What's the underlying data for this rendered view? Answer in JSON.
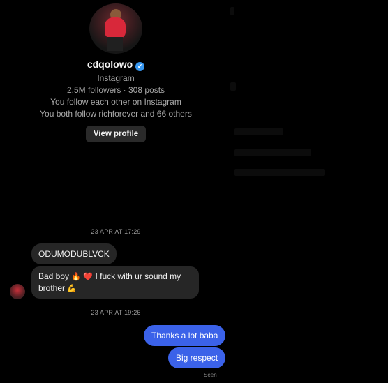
{
  "profile": {
    "username": "cdqolowo",
    "platform": "Instagram",
    "stats": "2.5M followers · 308 posts",
    "follow_status": "You follow each other on Instagram",
    "mutuals": "You both follow richforever and 66 others",
    "view_profile_label": "View profile"
  },
  "thread": {
    "timestamp_1": "23 APR AT 17:29",
    "incoming": [
      {
        "text": "ODUMODUBLVCK"
      },
      {
        "text_a": "Bad boy ",
        "emoji_1": "🔥",
        "emoji_2": "❤️",
        "text_b": " I fuck with ur sound my brother ",
        "emoji_3": "💪"
      }
    ],
    "timestamp_2": "23 APR AT 19:26",
    "outgoing": [
      {
        "text": "Thanks a lot baba"
      },
      {
        "text": "Big respect"
      }
    ],
    "seen_label": "Seen"
  },
  "colors": {
    "background": "#000000",
    "incoming_bubble": "#262626",
    "outgoing_bubble": "#3b62e9",
    "verified": "#3797f0"
  },
  "icons": [
    "verified-badge-icon",
    "avatar"
  ]
}
